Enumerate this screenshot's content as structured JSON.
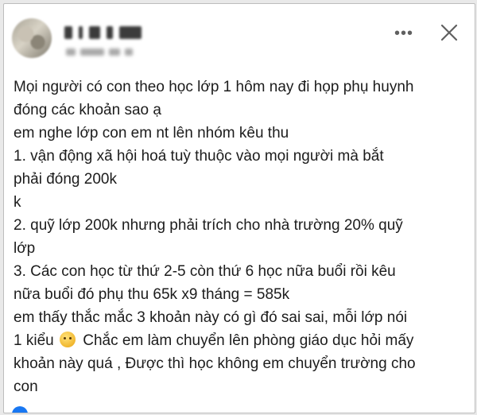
{
  "post": {
    "author_name": "",
    "meta": "",
    "lines": [
      "Mọi người có con theo học lớp 1 hôm nay đi họp phụ huynh",
      "đóng các khoản sao ạ",
      "em nghe lớp con em nt lên nhóm kêu thu",
      "1. vận động xã hội hoá tuỳ thuộc vào mọi người mà bắt",
      "phải đóng 200k",
      "k",
      "2. quỹ lớp 200k nhưng phải trích cho nhà trường 20% quỹ",
      "lớp",
      "3. Các con học từ thứ 2-5 còn thứ 6 học nữa buổi rồi kêu",
      "nữa buổi đó phụ thu 65k x9 tháng = 585k",
      "em thấy thắc mắc 3 khoản này có gì đó sai sai, mỗi lớp nói"
    ],
    "line_12_start": "1 kiểu",
    "line_12_end": "Chắc em làm chuyển lên phòng giáo dục hỏi mấy",
    "lines_after": [
      "khoản này quá , Được thì học không em chuyển trường cho",
      "con"
    ],
    "emoji": "thinking-face"
  },
  "header": {
    "more_icon": "more-options-icon",
    "close_icon": "close-icon"
  }
}
